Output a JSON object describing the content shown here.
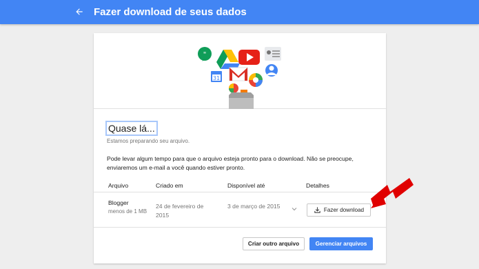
{
  "header": {
    "title": "Fazer download de seus dados",
    "back_icon": "arrow-back-icon",
    "bg_color": "#4285f4"
  },
  "card": {
    "heading": "Quase lá...",
    "subheading": "Estamos preparando seu arquivo.",
    "message": "Pode levar algum tempo para que o arquivo esteja pronto para o download. Não se preocupe, enviaremos um e-mail a você quando estiver pronto.",
    "table": {
      "columns": [
        "Arquivo",
        "Criado em",
        "Disponível até",
        "Detalhes"
      ],
      "rows": [
        {
          "name": "Blogger",
          "size": "menos de 1 MB",
          "created": "24 de fevereiro de 2015",
          "available_until": "3 de março de 2015",
          "action": "Fazer download"
        }
      ]
    },
    "buttons": {
      "create_another": "Criar outro arquivo",
      "manage": "Gerenciar arquivos"
    }
  },
  "hero_icons": [
    "hangouts-icon",
    "drive-icon",
    "youtube-icon",
    "contacts-icon",
    "calendar-icon",
    "gmail-icon",
    "picasa-icon",
    "profile-icon",
    "blogger-icon",
    "box-icon"
  ],
  "annotation": {
    "arrow_color": "#e00000"
  }
}
